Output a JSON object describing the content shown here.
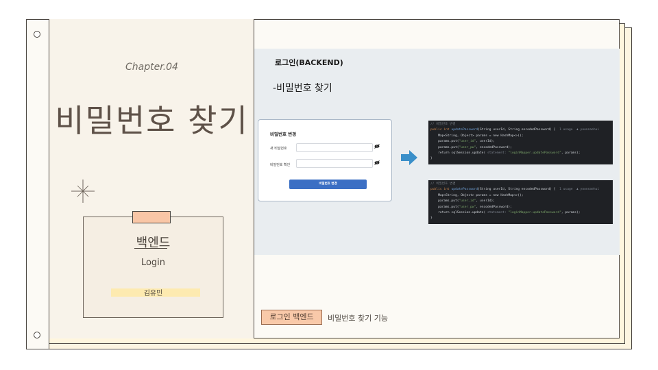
{
  "cover": {
    "chapter": "Chapter.04",
    "title": "비밀번호 찾기"
  },
  "card": {
    "title": "백엔드",
    "subtitle": "Login",
    "name": "김유민"
  },
  "content": {
    "section_title": "로그인(BACKEND)",
    "subtitle": "-비밀번호 찾기"
  },
  "form": {
    "title": "비밀번호 변경",
    "fields": [
      {
        "label": "새 비밀번호",
        "icon": "eye-slash-icon"
      },
      {
        "label": "비밀번호 확인",
        "icon": "eye-slash-icon"
      }
    ],
    "button": "비밀번호 변경"
  },
  "code_blocks": [
    {
      "comment": "// 비밀번호 변경",
      "signature_kw": "public int ",
      "signature_fn": "updatePassword",
      "signature_args": "(String userId, String encodedPassword) {",
      "hint": "1 usage  ♟ yoonnaehui",
      "line1": "    Map<String, Object> params = new HashMap<>();",
      "line2_a": "    params.put(",
      "line2_s": "\"user_id\"",
      "line2_b": ", userId);",
      "line3_a": "    params.put(",
      "line3_s": "\"user_pw\"",
      "line3_b": ", encodedPassword);",
      "line4_a": "    return sqlSession.update(",
      "line4_h": " statement: ",
      "line4_s": "\"loginMapper.updatePassword\"",
      "line4_b": ", params);",
      "close": "}"
    },
    {
      "comment": "// 비밀번호 변경",
      "signature_kw": "public int ",
      "signature_fn": "updatePassword",
      "signature_args": "(String userId, String encodedPassword) {",
      "hint": "1 usage  ♟ yoonnaehui",
      "line1": "    Map<String, Object> params = new HashMap<>();",
      "line2_a": "    params.put(",
      "line2_s": "\"user_id\"",
      "line2_b": ", userId);",
      "line3_a": "    params.put(",
      "line3_s": "\"user_pw\"",
      "line3_b": ", encodedPassword);",
      "line4_a": "    return sqlSession.update(",
      "line4_h": " statement: ",
      "line4_s": "\"loginMapper.updatePassword\"",
      "line4_b": ", params);",
      "close": "}"
    }
  ],
  "footer": {
    "tag": "로그인 백엔드",
    "description": "비밀번호 찾기 기능"
  },
  "colors": {
    "accent_peach": "#f9c6a6",
    "highlight_yellow": "#fdeab0",
    "button_blue": "#3b6fc4",
    "arrow_blue": "#3a8fc9",
    "code_bg": "#1f2125"
  }
}
